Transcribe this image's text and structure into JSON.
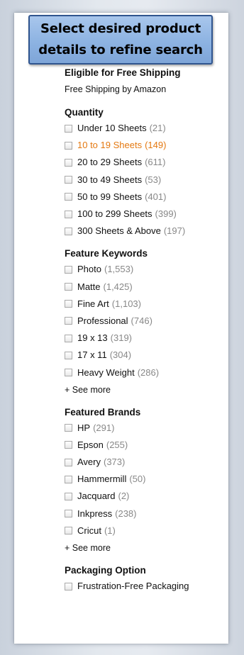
{
  "callout": {
    "line1": "Select desired product",
    "line2": "details to refine search"
  },
  "free_shipping": {
    "title": "Eligible for Free Shipping",
    "option": "Free Shipping by Amazon"
  },
  "quantity": {
    "title": "Quantity",
    "items": [
      {
        "label": "Under 10 Sheets",
        "count": "(21)"
      },
      {
        "label": "10 to 19 Sheets",
        "count": "(149)"
      },
      {
        "label": "20 to 29 Sheets",
        "count": "(611)"
      },
      {
        "label": "30 to 49 Sheets",
        "count": "(53)"
      },
      {
        "label": "50 to 99 Sheets",
        "count": "(401)"
      },
      {
        "label": "100 to 299 Sheets",
        "count": "(399)"
      },
      {
        "label": "300 Sheets & Above",
        "count": "(197)"
      }
    ]
  },
  "feature_keywords": {
    "title": "Feature Keywords",
    "items": [
      {
        "label": "Photo",
        "count": "(1,553)"
      },
      {
        "label": "Matte",
        "count": "(1,425)"
      },
      {
        "label": "Fine Art",
        "count": "(1,103)"
      },
      {
        "label": "Professional",
        "count": "(746)"
      },
      {
        "label": "19 x 13",
        "count": "(319)"
      },
      {
        "label": "17 x 11",
        "count": "(304)"
      },
      {
        "label": "Heavy Weight",
        "count": "(286)"
      }
    ],
    "see_more": "+ See more"
  },
  "featured_brands": {
    "title": "Featured Brands",
    "items": [
      {
        "label": "HP",
        "count": "(291)"
      },
      {
        "label": "Epson",
        "count": "(255)"
      },
      {
        "label": "Avery",
        "count": "(373)"
      },
      {
        "label": "Hammermill",
        "count": "(50)"
      },
      {
        "label": "Jacquard",
        "count": "(2)"
      },
      {
        "label": "Inkpress",
        "count": "(238)"
      },
      {
        "label": "Cricut",
        "count": "(1)"
      }
    ],
    "see_more": "+ See more"
  },
  "packaging": {
    "title": "Packaging Option",
    "items": [
      {
        "label": "Frustration-Free Packaging"
      }
    ]
  },
  "colors": {
    "selected": "#e47911",
    "count": "#888888",
    "callout_fill": "#8db3e2",
    "callout_border": "#30558f"
  }
}
